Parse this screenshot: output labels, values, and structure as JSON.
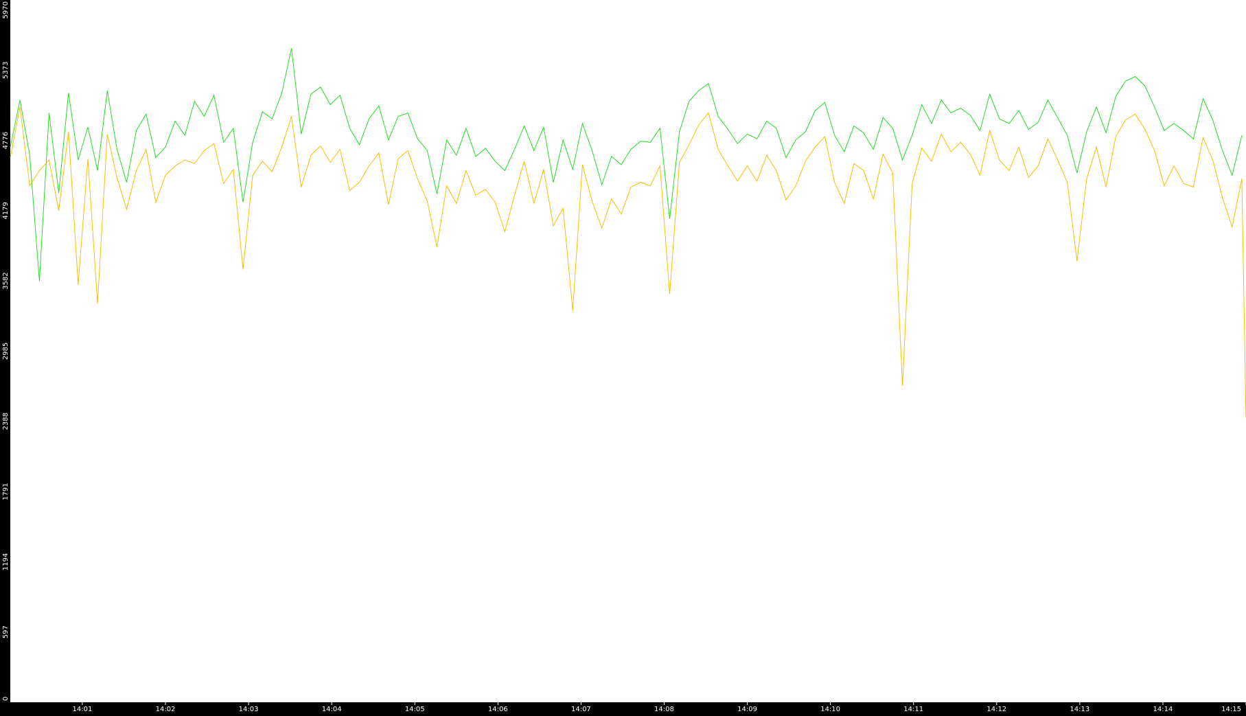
{
  "chart_data": {
    "type": "line",
    "title": "",
    "xlabel": "",
    "ylabel": "",
    "grid": false,
    "legend": "none",
    "background": "#000000",
    "plot_background": "#ffffff",
    "axis_text_color": "#ffffff",
    "y_ticks": [
      "0",
      "597",
      "1194",
      "1791",
      "2388",
      "2985",
      "3582",
      "4179",
      "4776",
      "5373",
      "5970"
    ],
    "y_tick_values": [
      0,
      597,
      1194,
      1791,
      2388,
      2985,
      3582,
      4179,
      4776,
      5373,
      5970
    ],
    "ylim": [
      0,
      5970
    ],
    "x_ticks": [
      "14:01",
      "14:02",
      "14:03",
      "14:04",
      "14:05",
      "14:06",
      "14:07",
      "14:08",
      "14:09",
      "14:10",
      "14:11",
      "14:12",
      "14:13",
      "14:14",
      "14:15"
    ],
    "xlim": [
      "14:00:08",
      "14:15:00"
    ],
    "series": [
      {
        "color": "#22dd22",
        "points": [
          [
            "14:00:08",
            4720
          ],
          [
            "14:00:15",
            5120
          ],
          [
            "14:00:22",
            4650
          ],
          [
            "14:00:29",
            3580
          ],
          [
            "14:00:36",
            5010
          ],
          [
            "14:00:43",
            4330
          ],
          [
            "14:00:50",
            5180
          ],
          [
            "14:00:57",
            4610
          ],
          [
            "14:01:04",
            4890
          ],
          [
            "14:01:11",
            4520
          ],
          [
            "14:01:18",
            5200
          ],
          [
            "14:01:25",
            4700
          ],
          [
            "14:01:32",
            4420
          ],
          [
            "14:01:39",
            4860
          ],
          [
            "14:01:46",
            5000
          ],
          [
            "14:01:53",
            4630
          ],
          [
            "14:02:00",
            4720
          ],
          [
            "14:02:07",
            4940
          ],
          [
            "14:02:14",
            4820
          ],
          [
            "14:02:21",
            5110
          ],
          [
            "14:02:28",
            4980
          ],
          [
            "14:02:35",
            5160
          ],
          [
            "14:02:42",
            4760
          ],
          [
            "14:02:49",
            4880
          ],
          [
            "14:02:56",
            4250
          ],
          [
            "14:03:03",
            4760
          ],
          [
            "14:03:10",
            5020
          ],
          [
            "14:03:17",
            4960
          ],
          [
            "14:03:24",
            5180
          ],
          [
            "14:03:31",
            5560
          ],
          [
            "14:03:38",
            4830
          ],
          [
            "14:03:45",
            5170
          ],
          [
            "14:03:52",
            5230
          ],
          [
            "14:03:59",
            5080
          ],
          [
            "14:04:06",
            5160
          ],
          [
            "14:04:13",
            4880
          ],
          [
            "14:04:20",
            4740
          ],
          [
            "14:04:27",
            4960
          ],
          [
            "14:04:34",
            5070
          ],
          [
            "14:04:41",
            4780
          ],
          [
            "14:04:48",
            4980
          ],
          [
            "14:04:55",
            5010
          ],
          [
            "14:05:02",
            4790
          ],
          [
            "14:05:09",
            4690
          ],
          [
            "14:05:16",
            4320
          ],
          [
            "14:05:23",
            4780
          ],
          [
            "14:05:30",
            4650
          ],
          [
            "14:05:37",
            4880
          ],
          [
            "14:05:44",
            4640
          ],
          [
            "14:05:51",
            4710
          ],
          [
            "14:05:58",
            4600
          ],
          [
            "14:06:05",
            4520
          ],
          [
            "14:06:12",
            4700
          ],
          [
            "14:06:19",
            4900
          ],
          [
            "14:06:26",
            4690
          ],
          [
            "14:06:33",
            4890
          ],
          [
            "14:06:40",
            4420
          ],
          [
            "14:06:47",
            4780
          ],
          [
            "14:06:54",
            4530
          ],
          [
            "14:07:01",
            4920
          ],
          [
            "14:07:08",
            4690
          ],
          [
            "14:07:15",
            4400
          ],
          [
            "14:07:22",
            4640
          ],
          [
            "14:07:29",
            4570
          ],
          [
            "14:07:36",
            4700
          ],
          [
            "14:07:43",
            4770
          ],
          [
            "14:07:50",
            4760
          ],
          [
            "14:07:57",
            4880
          ],
          [
            "14:08:04",
            4110
          ],
          [
            "14:08:11",
            4850
          ],
          [
            "14:08:18",
            5110
          ],
          [
            "14:08:25",
            5200
          ],
          [
            "14:08:32",
            5260
          ],
          [
            "14:08:39",
            4980
          ],
          [
            "14:08:46",
            4870
          ],
          [
            "14:08:53",
            4750
          ],
          [
            "14:09:00",
            4830
          ],
          [
            "14:09:07",
            4790
          ],
          [
            "14:09:14",
            4940
          ],
          [
            "14:09:21",
            4880
          ],
          [
            "14:09:28",
            4630
          ],
          [
            "14:09:35",
            4780
          ],
          [
            "14:09:42",
            4850
          ],
          [
            "14:09:49",
            5030
          ],
          [
            "14:09:56",
            5100
          ],
          [
            "14:10:03",
            4820
          ],
          [
            "14:10:10",
            4680
          ],
          [
            "14:10:17",
            4900
          ],
          [
            "14:10:24",
            4840
          ],
          [
            "14:10:31",
            4700
          ],
          [
            "14:10:38",
            4970
          ],
          [
            "14:10:45",
            4880
          ],
          [
            "14:10:52",
            4610
          ],
          [
            "14:10:59",
            4820
          ],
          [
            "14:11:06",
            5080
          ],
          [
            "14:11:13",
            4920
          ],
          [
            "14:11:20",
            5120
          ],
          [
            "14:11:27",
            5010
          ],
          [
            "14:11:34",
            5050
          ],
          [
            "14:11:41",
            4990
          ],
          [
            "14:11:48",
            4860
          ],
          [
            "14:11:55",
            5170
          ],
          [
            "14:12:02",
            4960
          ],
          [
            "14:12:09",
            4920
          ],
          [
            "14:12:16",
            5030
          ],
          [
            "14:12:23",
            4870
          ],
          [
            "14:12:30",
            4930
          ],
          [
            "14:12:37",
            5120
          ],
          [
            "14:12:44",
            4970
          ],
          [
            "14:12:51",
            4820
          ],
          [
            "14:12:58",
            4500
          ],
          [
            "14:13:05",
            4850
          ],
          [
            "14:13:12",
            5060
          ],
          [
            "14:13:19",
            4840
          ],
          [
            "14:13:26",
            5150
          ],
          [
            "14:13:33",
            5280
          ],
          [
            "14:13:40",
            5320
          ],
          [
            "14:13:47",
            5240
          ],
          [
            "14:13:54",
            5060
          ],
          [
            "14:14:01",
            4860
          ],
          [
            "14:14:08",
            4920
          ],
          [
            "14:14:15",
            4860
          ],
          [
            "14:14:22",
            4790
          ],
          [
            "14:14:29",
            5130
          ],
          [
            "14:14:36",
            4950
          ],
          [
            "14:14:43",
            4690
          ],
          [
            "14:14:50",
            4480
          ],
          [
            "14:14:57",
            4820
          ]
        ]
      },
      {
        "color": "#ffbb00",
        "points": [
          [
            "14:00:08",
            4630
          ],
          [
            "14:00:15",
            5060
          ],
          [
            "14:00:22",
            4390
          ],
          [
            "14:00:29",
            4520
          ],
          [
            "14:00:36",
            4610
          ],
          [
            "14:00:43",
            4180
          ],
          [
            "14:00:50",
            4850
          ],
          [
            "14:00:57",
            3550
          ],
          [
            "14:01:04",
            4620
          ],
          [
            "14:01:11",
            3390
          ],
          [
            "14:01:18",
            4830
          ],
          [
            "14:01:25",
            4460
          ],
          [
            "14:01:32",
            4190
          ],
          [
            "14:01:39",
            4520
          ],
          [
            "14:01:46",
            4700
          ],
          [
            "14:01:53",
            4250
          ],
          [
            "14:02:00",
            4480
          ],
          [
            "14:02:07",
            4560
          ],
          [
            "14:02:14",
            4610
          ],
          [
            "14:02:21",
            4580
          ],
          [
            "14:02:28",
            4690
          ],
          [
            "14:02:35",
            4750
          ],
          [
            "14:02:42",
            4410
          ],
          [
            "14:02:49",
            4530
          ],
          [
            "14:02:56",
            3680
          ],
          [
            "14:03:03",
            4480
          ],
          [
            "14:03:10",
            4600
          ],
          [
            "14:03:17",
            4510
          ],
          [
            "14:03:24",
            4720
          ],
          [
            "14:03:31",
            4980
          ],
          [
            "14:03:38",
            4380
          ],
          [
            "14:03:45",
            4650
          ],
          [
            "14:03:52",
            4730
          ],
          [
            "14:03:59",
            4590
          ],
          [
            "14:04:06",
            4700
          ],
          [
            "14:04:13",
            4350
          ],
          [
            "14:04:20",
            4420
          ],
          [
            "14:04:27",
            4560
          ],
          [
            "14:04:34",
            4670
          ],
          [
            "14:04:41",
            4230
          ],
          [
            "14:04:48",
            4620
          ],
          [
            "14:04:55",
            4690
          ],
          [
            "14:05:02",
            4450
          ],
          [
            "14:05:09",
            4260
          ],
          [
            "14:05:16",
            3870
          ],
          [
            "14:05:23",
            4390
          ],
          [
            "14:05:30",
            4240
          ],
          [
            "14:05:37",
            4520
          ],
          [
            "14:05:44",
            4310
          ],
          [
            "14:05:51",
            4360
          ],
          [
            "14:05:58",
            4250
          ],
          [
            "14:06:05",
            4000
          ],
          [
            "14:06:12",
            4310
          ],
          [
            "14:06:19",
            4600
          ],
          [
            "14:06:26",
            4240
          ],
          [
            "14:06:33",
            4530
          ],
          [
            "14:06:40",
            4050
          ],
          [
            "14:06:47",
            4200
          ],
          [
            "14:06:54",
            3330
          ],
          [
            "14:07:01",
            4570
          ],
          [
            "14:07:08",
            4260
          ],
          [
            "14:07:15",
            4030
          ],
          [
            "14:07:22",
            4280
          ],
          [
            "14:07:29",
            4150
          ],
          [
            "14:07:36",
            4380
          ],
          [
            "14:07:43",
            4420
          ],
          [
            "14:07:50",
            4390
          ],
          [
            "14:07:57",
            4560
          ],
          [
            "14:08:04",
            3470
          ],
          [
            "14:08:11",
            4590
          ],
          [
            "14:08:18",
            4740
          ],
          [
            "14:08:25",
            4910
          ],
          [
            "14:08:32",
            5010
          ],
          [
            "14:08:39",
            4700
          ],
          [
            "14:08:46",
            4560
          ],
          [
            "14:08:53",
            4430
          ],
          [
            "14:09:00",
            4560
          ],
          [
            "14:09:07",
            4430
          ],
          [
            "14:09:14",
            4650
          ],
          [
            "14:09:21",
            4520
          ],
          [
            "14:09:28",
            4270
          ],
          [
            "14:09:35",
            4390
          ],
          [
            "14:09:42",
            4600
          ],
          [
            "14:09:49",
            4720
          ],
          [
            "14:09:56",
            4810
          ],
          [
            "14:10:03",
            4420
          ],
          [
            "14:10:10",
            4240
          ],
          [
            "14:10:17",
            4580
          ],
          [
            "14:10:24",
            4520
          ],
          [
            "14:10:31",
            4280
          ],
          [
            "14:10:38",
            4660
          ],
          [
            "14:10:45",
            4500
          ],
          [
            "14:10:52",
            2690
          ],
          [
            "14:10:59",
            4410
          ],
          [
            "14:11:06",
            4710
          ],
          [
            "14:11:13",
            4600
          ],
          [
            "14:11:20",
            4830
          ],
          [
            "14:11:27",
            4680
          ],
          [
            "14:11:34",
            4760
          ],
          [
            "14:11:41",
            4660
          ],
          [
            "14:11:48",
            4480
          ],
          [
            "14:11:55",
            4860
          ],
          [
            "14:12:02",
            4610
          ],
          [
            "14:12:09",
            4520
          ],
          [
            "14:12:16",
            4720
          ],
          [
            "14:12:23",
            4460
          ],
          [
            "14:12:30",
            4560
          ],
          [
            "14:12:37",
            4790
          ],
          [
            "14:12:44",
            4610
          ],
          [
            "14:12:51",
            4420
          ],
          [
            "14:12:58",
            3750
          ],
          [
            "14:13:05",
            4450
          ],
          [
            "14:13:12",
            4720
          ],
          [
            "14:13:19",
            4380
          ],
          [
            "14:13:26",
            4810
          ],
          [
            "14:13:33",
            4950
          ],
          [
            "14:13:40",
            5000
          ],
          [
            "14:13:47",
            4870
          ],
          [
            "14:13:54",
            4690
          ],
          [
            "14:14:01",
            4390
          ],
          [
            "14:14:08",
            4560
          ],
          [
            "14:14:15",
            4410
          ],
          [
            "14:14:22",
            4380
          ],
          [
            "14:14:29",
            4800
          ],
          [
            "14:14:36",
            4610
          ],
          [
            "14:14:43",
            4290
          ],
          [
            "14:14:50",
            4040
          ],
          [
            "14:14:57",
            4450
          ],
          [
            "14:15:00",
            2420
          ]
        ]
      }
    ]
  }
}
